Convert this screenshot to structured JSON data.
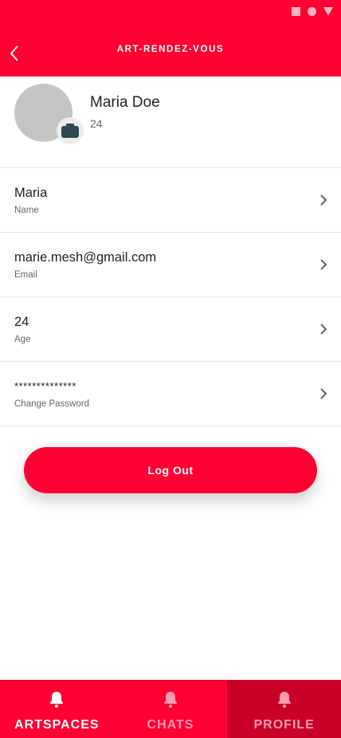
{
  "header": {
    "title": "ART-RENDEZ-VOUS"
  },
  "profile": {
    "name": "Maria Doe",
    "age": "24"
  },
  "fields": [
    {
      "value": "Maria",
      "label": "Name"
    },
    {
      "value": "marie.mesh@gmail.com",
      "label": "Email"
    },
    {
      "value": "24",
      "label": "Age"
    },
    {
      "value": "**************",
      "label": "Change Password"
    }
  ],
  "logout_label": "Log Out",
  "tabs": [
    {
      "label": "ARTSPACES",
      "icon": "bell-icon",
      "color": "#ffffff"
    },
    {
      "label": "CHATS",
      "icon": "bell-icon",
      "color": "#ff9aae"
    },
    {
      "label": "PROFILE",
      "icon": "bell-icon",
      "color": "#ff9aae"
    }
  ],
  "colors": {
    "accent": "#ff0032",
    "active_tab": "#c90028",
    "camera_icon": "#2f4a55"
  }
}
